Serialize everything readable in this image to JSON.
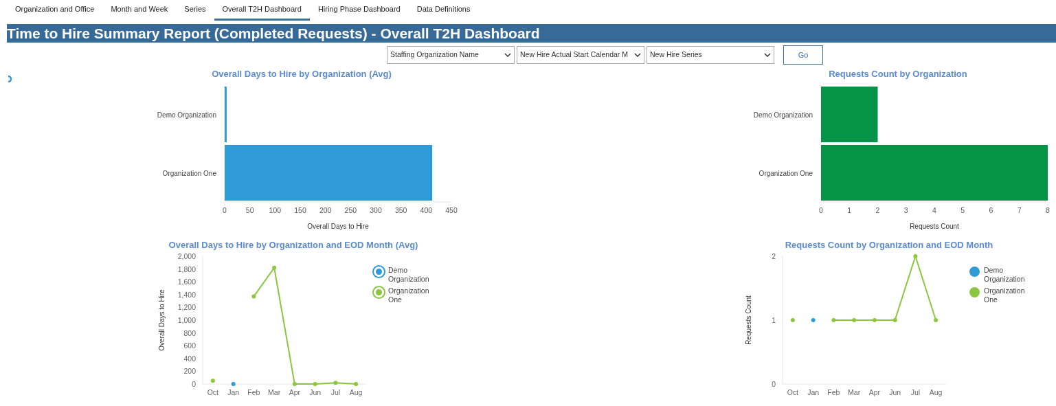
{
  "tabs": [
    {
      "label": "Organization and Office",
      "selected": false
    },
    {
      "label": "Month and Week",
      "selected": false
    },
    {
      "label": "Series",
      "selected": false
    },
    {
      "label": "Overall T2H Dashboard",
      "selected": true
    },
    {
      "label": "Hiring Phase Dashboard",
      "selected": false
    },
    {
      "label": "Data Definitions",
      "selected": false
    }
  ],
  "report_title": "Time to Hire Summary Report (Completed Requests) - Overall T2H Dashboard",
  "filters": [
    {
      "value": "Staffing Organization Name"
    },
    {
      "value": "New Hire Actual Start Calendar M"
    },
    {
      "value": "New Hire Series"
    }
  ],
  "go_button": "Go",
  "charts": [
    {
      "chart_data": {
        "type": "bar",
        "orientation": "horizontal",
        "title": "Overall Days to Hire by Organization (Avg)",
        "xlabel": "Overall Days to Hire",
        "categories": [
          "Demo Organization",
          "Organization One"
        ],
        "series": [
          {
            "color": "#2e9bd6",
            "values": [
              4,
              412
            ]
          }
        ],
        "xlim": [
          0,
          450
        ],
        "xticks": [
          0,
          50,
          100,
          150,
          200,
          250,
          300,
          350,
          400,
          450
        ]
      }
    },
    {
      "chart_data": {
        "type": "bar",
        "orientation": "horizontal",
        "title": "Requests Count by Organization",
        "xlabel": "Requests Count",
        "categories": [
          "Demo Organization",
          "Organization One"
        ],
        "series": [
          {
            "color": "#059447",
            "values": [
              2,
              8
            ]
          }
        ],
        "xlim": [
          0,
          8
        ],
        "xticks": [
          0,
          1,
          2,
          3,
          4,
          5,
          6,
          7,
          8
        ]
      }
    },
    {
      "chart_data": {
        "type": "line",
        "title": "Overall Days to Hire by Organization and EOD Month (Avg)",
        "ylabel": "Overall Days to Hire",
        "categories": [
          "Oct",
          "Jan",
          "Feb",
          "Mar",
          "Apr",
          "Jun",
          "Jul",
          "Aug"
        ],
        "series": [
          {
            "name": "Demo Organization",
            "color": "#2e9bd6",
            "marker": true,
            "values": [
              null,
              0,
              null,
              null,
              null,
              null,
              null,
              null
            ]
          },
          {
            "name": "Organization One",
            "color": "#8cc63f",
            "marker": true,
            "values": [
              50,
              null,
              1370,
              1820,
              0,
              0,
              20,
              0
            ]
          }
        ],
        "ylim": [
          0,
          2000
        ],
        "yticks": [
          {
            "value": 0,
            "label": "0"
          },
          {
            "value": 200,
            "label": "200"
          },
          {
            "value": 400,
            "label": "400"
          },
          {
            "value": 600,
            "label": "600"
          },
          {
            "value": 800,
            "label": "800"
          },
          {
            "value": 1000,
            "label": "1,000"
          },
          {
            "value": 1200,
            "label": "1,200"
          },
          {
            "value": 1400,
            "label": "1,400"
          },
          {
            "value": 1600,
            "label": "1,600"
          },
          {
            "value": 1800,
            "label": "1,800"
          },
          {
            "value": 2000,
            "label": "2,000"
          }
        ]
      }
    },
    {
      "chart_data": {
        "type": "line",
        "title": "Requests Count by Organization and EOD Month",
        "ylabel": "Requests Count",
        "categories": [
          "Oct",
          "Jan",
          "Feb",
          "Mar",
          "Apr",
          "Jun",
          "Jul",
          "Aug"
        ],
        "series": [
          {
            "name": "Demo Organization",
            "color": "#2e9bd6",
            "marker": true,
            "values": [
              null,
              1,
              null,
              null,
              null,
              null,
              null,
              null
            ]
          },
          {
            "name": "Organization One",
            "color": "#8cc63f",
            "marker": true,
            "values": [
              1,
              null,
              1,
              1,
              1,
              1,
              2,
              1
            ]
          }
        ],
        "ylim": [
          0,
          2
        ],
        "yticks": [
          0,
          1,
          2
        ]
      }
    }
  ]
}
